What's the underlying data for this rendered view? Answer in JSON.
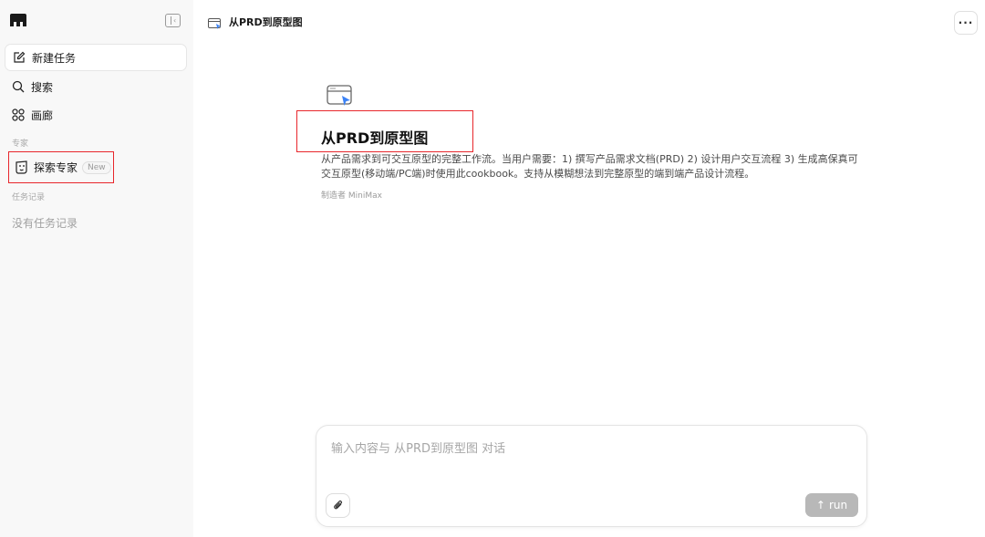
{
  "sidebar": {
    "new_task": "新建任务",
    "search": "搜索",
    "gallery": "画廊",
    "experts_section": "专家",
    "explore_experts": "探索专家",
    "new_badge": "New",
    "history_section": "任务记录",
    "empty_history": "没有任务记录"
  },
  "header": {
    "title": "从PRD到原型图",
    "more": "···"
  },
  "card": {
    "title": "从PRD到原型图",
    "description": "从产品需求到可交互原型的完整工作流。当用户需要：1) 撰写产品需求文档(PRD) 2) 设计用户交互流程 3) 生成高保真可交互原型(移动端/PC端)时使用此cookbook。支持从模糊想法到完整原型的端到端产品设计流程。",
    "author": "制造者 MiniMax"
  },
  "composer": {
    "placeholder": "输入内容与 从PRD到原型图 对话",
    "value": "",
    "run_label": "run"
  },
  "colors": {
    "highlight": "#e8262b",
    "sidebar_bg": "#f8f8f8",
    "run_button": "#b8b8b8"
  },
  "icons": {
    "logo": "app-logo-icon",
    "collapse": "sidebar-collapse-icon",
    "new_task": "edit-icon",
    "search": "search-icon",
    "gallery": "grid-icon",
    "explore": "expert-icon",
    "header": "window-cursor-icon",
    "attach": "paperclip-icon",
    "run": "arrow-up-icon"
  }
}
